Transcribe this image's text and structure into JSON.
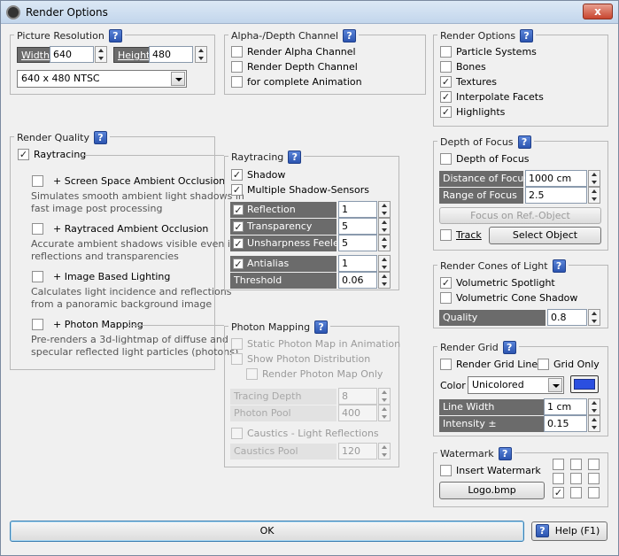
{
  "window": {
    "title": "Render Options",
    "close_label": "x"
  },
  "picture_resolution": {
    "title": "Picture Resolution",
    "width_label": "Width",
    "width_value": "640",
    "height_label": "Height",
    "height_value": "480",
    "preset": "640 x 480  NTSC"
  },
  "alpha_depth": {
    "title": "Alpha-/Depth Channel",
    "items": [
      {
        "label": "Render Alpha Channel",
        "checked": false
      },
      {
        "label": "Render Depth Channel",
        "checked": false
      },
      {
        "label": "for complete Animation",
        "checked": false
      }
    ]
  },
  "render_options": {
    "title": "Render Options",
    "items": [
      {
        "label": "Particle Systems",
        "checked": false
      },
      {
        "label": "Bones",
        "checked": false
      },
      {
        "label": "Textures",
        "checked": true
      },
      {
        "label": "Interpolate Facets",
        "checked": true
      },
      {
        "label": "Highlights",
        "checked": true
      }
    ]
  },
  "render_quality": {
    "title": "Render Quality",
    "raytracing_label": "Raytracing",
    "raytracing_checked": true,
    "items": [
      {
        "label": "+ Screen Space Ambient Occlusion",
        "desc1": "Simulates smooth ambient light shadows in",
        "desc2": "fast image post processing",
        "checked": false
      },
      {
        "label": "+ Raytraced Ambient Occlusion",
        "desc1": "Accurate ambient shadows visible even in",
        "desc2": "reflections and transparencies",
        "checked": false
      },
      {
        "label": "+ Image Based Lighting",
        "desc1": "Calculates light incidence and reflections",
        "desc2": "from a panoramic background image",
        "checked": false
      },
      {
        "label": "+ Photon Mapping",
        "desc1": "Pre-renders a 3d-lightmap of diffuse and",
        "desc2": "specular reflected light particles (photons)",
        "checked": false
      }
    ]
  },
  "raytracing": {
    "title": "Raytracing",
    "shadow_label": "Shadow",
    "multi_shadow_label": "Multiple Shadow-Sensors",
    "reflection_label": "Reflection",
    "reflection_value": "1",
    "transparency_label": "Transparency",
    "transparency_value": "5",
    "unsharpness_label": "Unsharpness Feeler",
    "unsharpness_value": "5",
    "antialias_label": "Antialias",
    "antialias_value": "1",
    "threshold_label": "Threshold",
    "threshold_value": "0.06"
  },
  "photon_mapping": {
    "title": "Photon Mapping",
    "static_label": "Static Photon Map in Animation",
    "show_dist_label": "Show Photon Distribution",
    "render_only_label": "Render Photon Map Only",
    "tracing_depth_label": "Tracing Depth",
    "tracing_depth_value": "8",
    "photon_pool_label": "Photon Pool",
    "photon_pool_value": "400",
    "caustics_label": "Caustics - Light Reflections",
    "caustics_pool_label": "Caustics Pool",
    "caustics_pool_value": "120"
  },
  "depth_of_focus": {
    "title": "Depth of Focus",
    "enable_label": "Depth of Focus",
    "distance_label": "Distance of Focus",
    "distance_value": "1000 cm",
    "range_label": "Range of Focus",
    "range_value": "2.5",
    "focus_ref_label": "Focus on Ref.-Object",
    "track_label": "Track",
    "select_object_label": "Select Object"
  },
  "render_cones": {
    "title": "Render Cones of Light",
    "volumetric_spot_label": "Volumetric Spotlight",
    "volumetric_cone_label": "Volumetric Cone Shadow",
    "quality_label": "Quality",
    "quality_value": "0.8"
  },
  "render_grid": {
    "title": "Render Grid",
    "grid_lines_label": "Render Grid Lines",
    "grid_only_label": "Grid Only",
    "color_label": "Color",
    "color_value": "Unicolored",
    "swatch_color": "#2b4fe0",
    "line_width_label": "Line Width",
    "line_width_value": "1 cm",
    "intensity_label": "Intensity ±",
    "intensity_value": "0.15"
  },
  "watermark": {
    "title": "Watermark",
    "insert_label": "Insert Watermark",
    "file_label": "Logo.bmp"
  },
  "footer": {
    "ok_label": "OK",
    "help_label": "Help (F1)"
  },
  "help_glyph": "?"
}
